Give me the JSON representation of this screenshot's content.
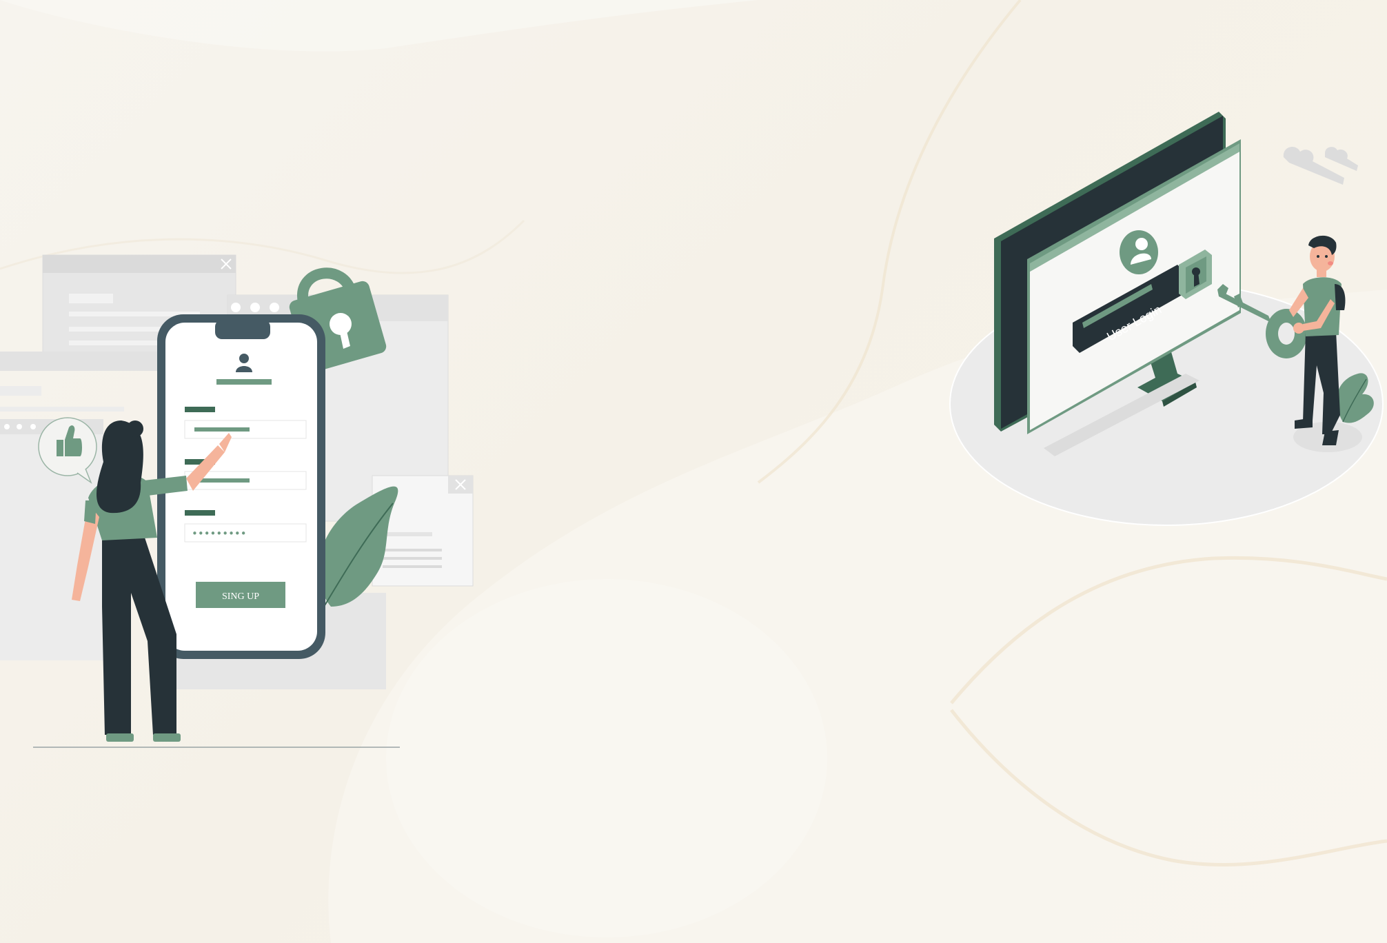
{
  "signup_illustration": {
    "button_label": "SING UP",
    "password_mask": "•••••••••"
  },
  "login_illustration": {
    "screen_label": "User Login"
  },
  "colors": {
    "accent": "#6f9a82",
    "accent_dark": "#3e6b56",
    "dark": "#263238",
    "phone_frame": "#455a64",
    "background": "#f6f3ec",
    "panel_gray": "#e9e9e9"
  },
  "icons": [
    "user-icon",
    "padlock-icon",
    "thumbs-up-icon",
    "close-icon",
    "key-icon",
    "keyhole-icon",
    "cloud-icon",
    "leaf-icon"
  ]
}
